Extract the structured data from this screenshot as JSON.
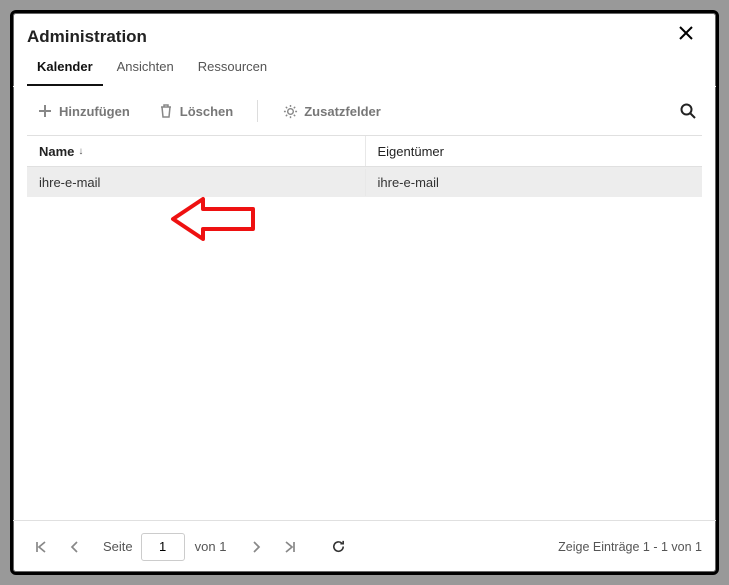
{
  "dialog": {
    "title": "Administration"
  },
  "tabs": {
    "items": [
      {
        "label": "Kalender",
        "active": true
      },
      {
        "label": "Ansichten",
        "active": false
      },
      {
        "label": "Ressourcen",
        "active": false
      }
    ]
  },
  "toolbar": {
    "add": "Hinzufügen",
    "delete": "Löschen",
    "extra": "Zusatzfelder"
  },
  "table": {
    "columns": {
      "name": "Name",
      "owner": "Eigentümer"
    },
    "rows": [
      {
        "name": "ihre-e-mail",
        "owner": "ihre-e-mail"
      }
    ]
  },
  "paginator": {
    "page_label": "Seite",
    "page": "1",
    "of_label": "von 1",
    "status": "Zeige Einträge 1 - 1 von 1"
  }
}
